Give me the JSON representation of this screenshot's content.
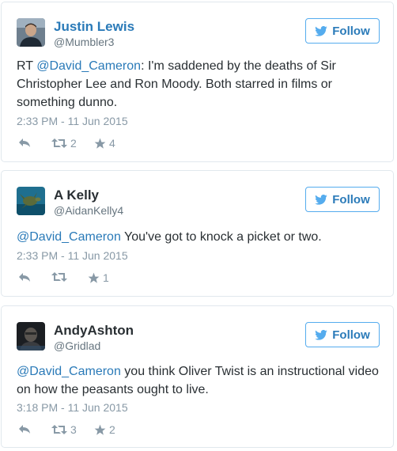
{
  "follow_label": "Follow",
  "colors": {
    "link": "#2a7ab8",
    "follow_border": "#55acee",
    "meta": "#8899a6"
  },
  "tweets": [
    {
      "name": "Justin Lewis",
      "handle": "@Mumbler3",
      "text_prefix": "RT ",
      "mention": "@David_Cameron",
      "text_rest": ": I'm saddened by the deaths of Sir Christopher Lee and Ron Moody. Both starred in films or something dunno.",
      "time": "2:33 PM - 11 Jun 2015",
      "retweets": "2",
      "favorites": "4"
    },
    {
      "name": "A Kelly",
      "handle": "@AidanKelly4",
      "text_prefix": "",
      "mention": "@David_Cameron",
      "text_rest": " You've got to knock a picket or two.",
      "time": "2:33 PM - 11 Jun 2015",
      "retweets": "",
      "favorites": "1"
    },
    {
      "name": "AndyAshton",
      "handle": "@Gridlad",
      "text_prefix": "",
      "mention": "@David_Cameron",
      "text_rest": " you think Oliver Twist is an instructional video on how the peasants ought to live.",
      "time": "3:18 PM - 11 Jun 2015",
      "retweets": "3",
      "favorites": "2"
    }
  ]
}
